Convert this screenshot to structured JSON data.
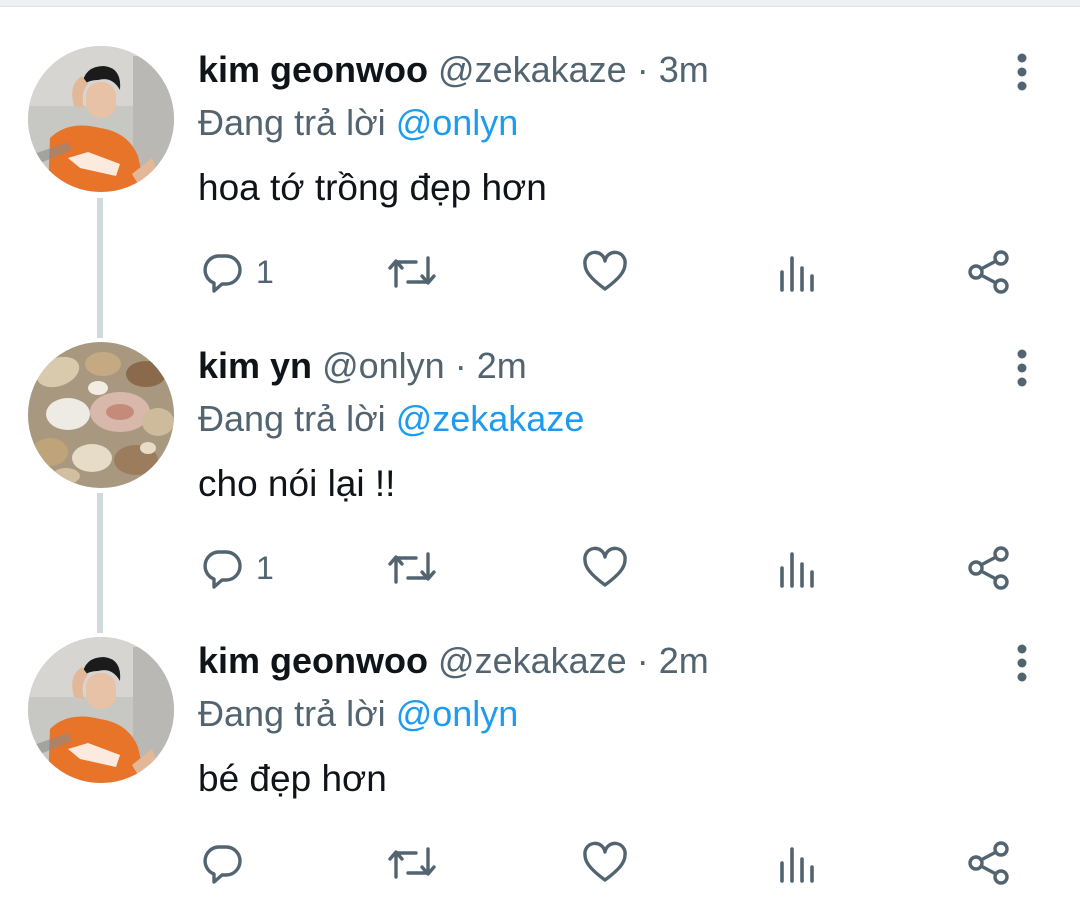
{
  "colors": {
    "text": "#0f1419",
    "secondary": "#536471",
    "link": "#1d9bf0",
    "thread_line": "#cfd9de"
  },
  "tweets": [
    {
      "name": "kim geonwoo",
      "handle": "@zekakaze",
      "separator": "·",
      "time": "3m",
      "replying_label": "Đang trả lời",
      "replying_to": "@onlyn",
      "text": "hoa tớ trồng đẹp hơn",
      "reply_count": "1",
      "avatar": "person-orange-jersey"
    },
    {
      "name": "kim yn",
      "handle": "@onlyn",
      "separator": "·",
      "time": "2m",
      "replying_label": "Đang trả lời",
      "replying_to": "@zekakaze",
      "text": "cho nói lại !!",
      "reply_count": "1",
      "avatar": "seashells"
    },
    {
      "name": "kim geonwoo",
      "handle": "@zekakaze",
      "separator": "·",
      "time": "2m",
      "replying_label": "Đang trả lời",
      "replying_to": "@onlyn",
      "text": "bé đẹp hơn",
      "reply_count": "",
      "avatar": "person-orange-jersey"
    }
  ],
  "icons": {
    "reply": "reply-icon",
    "retweet": "retweet-icon",
    "like": "heart-icon",
    "analytics": "analytics-icon",
    "share": "share-icon",
    "more": "more-vertical-icon"
  }
}
